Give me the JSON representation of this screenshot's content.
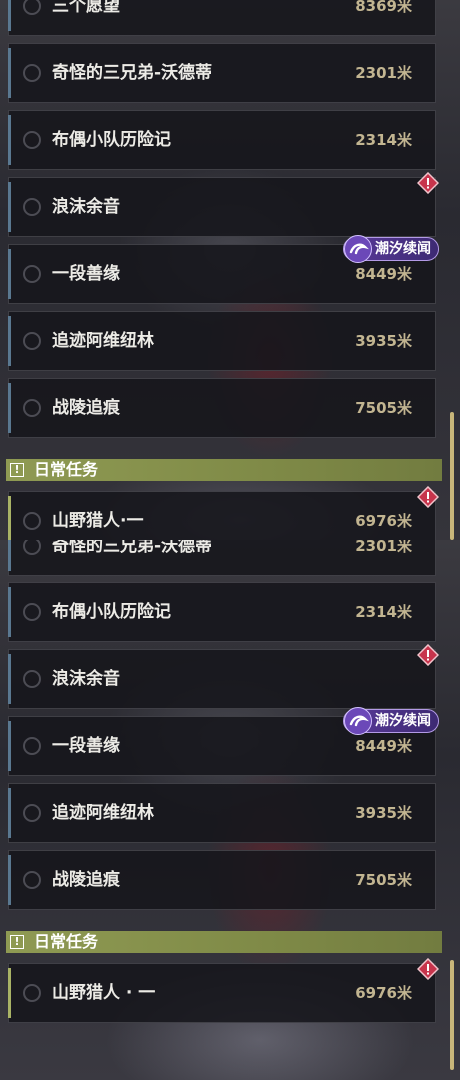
{
  "colors": {
    "accent_blue": "#5a7890",
    "accent_green": "#a9b366",
    "distance": "#c2b591",
    "badge_red": "#c7344c",
    "tag_purple": "#5a3a9a"
  },
  "panel1": {
    "rows": [
      {
        "name": "三个愿望",
        "distance": "8369米"
      },
      {
        "name": "奇怪的三兄弟-沃德蒂",
        "distance": "2301米"
      },
      {
        "name": "布偶小队历险记",
        "distance": "2314米"
      },
      {
        "name": "浪沫余音",
        "distance": ""
      },
      {
        "name": "一段善缘",
        "distance": "8449米"
      },
      {
        "name": "追迹阿维纽林",
        "distance": "3935米"
      },
      {
        "name": "战陵追痕",
        "distance": "7505米"
      }
    ],
    "tag": "潮汐续闻",
    "section": "日常任务",
    "daily_row": {
      "name": "山野猎人·一",
      "distance": "6976米"
    }
  },
  "panel2": {
    "rows": [
      {
        "name": "奇怪的三兄弟-沃德蒂",
        "distance": "2301米"
      },
      {
        "name": "布偶小队历险记",
        "distance": "2314米"
      },
      {
        "name": "浪沫余音",
        "distance": ""
      },
      {
        "name": "一段善缘",
        "distance": "8449米"
      },
      {
        "name": "追迹阿维纽林",
        "distance": "3935米"
      },
      {
        "name": "战陵追痕",
        "distance": "7505米"
      }
    ],
    "tag": "潮汐续闻",
    "section": "日常任务",
    "daily_row": {
      "name": "山野猎人 · 一",
      "distance": "6976米"
    }
  }
}
